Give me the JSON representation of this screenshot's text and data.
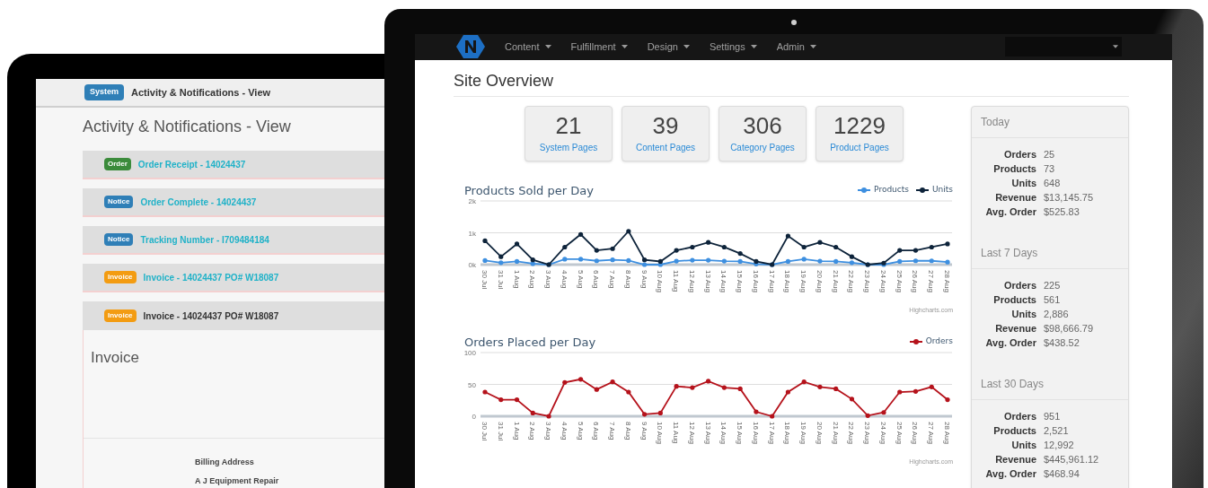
{
  "tablet": {
    "header": {
      "badge": "System",
      "title": "Activity & Notifications - View"
    },
    "heading": "Activity & Notifications - View",
    "items": [
      {
        "badge": "Order",
        "color": "#3b8b3b",
        "title": "Order Receipt - 14024437",
        "expanded": false
      },
      {
        "badge": "Notice",
        "color": "#2f7fb7",
        "title": "Order Complete - 14024437",
        "expanded": false
      },
      {
        "badge": "Notice",
        "color": "#2f7fb7",
        "title": "Tracking Number - I709484184",
        "expanded": false
      },
      {
        "badge": "Invoice",
        "color": "#f39c12",
        "title": "Invoice - 14024437 PO# W18087",
        "expanded": false
      },
      {
        "badge": "Invoice",
        "color": "#f39c12",
        "title": "Invoice - 14024437 PO# W18087",
        "expanded": true
      }
    ],
    "invoice": {
      "heading": "Invoice",
      "billing_label": "Billing Address",
      "billing_name": "A J Equipment Repair"
    }
  },
  "laptop": {
    "nav": {
      "menus": [
        "Content",
        "Fulfillment",
        "Design",
        "Settings",
        "Admin"
      ]
    },
    "title": "Site Overview",
    "stats": [
      {
        "value": "21",
        "label": "System Pages"
      },
      {
        "value": "39",
        "label": "Content Pages"
      },
      {
        "value": "306",
        "label": "Category Pages"
      },
      {
        "value": "1229",
        "label": "Product Pages"
      }
    ],
    "charts": [
      {
        "credit": "Highcharts.com",
        "chart_data": {
          "type": "line",
          "title": "Products Sold per Day",
          "categories": [
            "30 Jul",
            "31 Jul",
            "1 Aug",
            "2 Aug",
            "3 Aug",
            "4 Aug",
            "5 Aug",
            "6 Aug",
            "7 Aug",
            "8 Aug",
            "9 Aug",
            "10 Aug",
            "11 Aug",
            "12 Aug",
            "13 Aug",
            "14 Aug",
            "15 Aug",
            "16 Aug",
            "17 Aug",
            "18 Aug",
            "19 Aug",
            "20 Aug",
            "21 Aug",
            "22 Aug",
            "23 Aug",
            "24 Aug",
            "25 Aug",
            "26 Aug",
            "27 Aug",
            "28 Aug"
          ],
          "series": [
            {
              "name": "Products",
              "color": "#3d8fe0",
              "values": [
                130,
                60,
                100,
                30,
                0,
                170,
                170,
                120,
                150,
                130,
                0,
                0,
                110,
                140,
                140,
                110,
                100,
                20,
                0,
                100,
                170,
                110,
                100,
                60,
                0,
                0,
                100,
                120,
                120,
                80
              ]
            },
            {
              "name": "Units",
              "color": "#0d233a",
              "values": [
                750,
                250,
                650,
                150,
                0,
                550,
                950,
                450,
                500,
                1050,
                150,
                100,
                450,
                550,
                700,
                550,
                350,
                100,
                0,
                900,
                550,
                700,
                550,
                250,
                0,
                50,
                450,
                450,
                550,
                650
              ]
            }
          ],
          "legend": "top-right",
          "ylim": [
            0,
            2000
          ],
          "yticks": [
            {
              "value": 0,
              "label": "0k"
            },
            {
              "value": 1000,
              "label": "1k"
            },
            {
              "value": 2000,
              "label": "2k"
            }
          ]
        }
      },
      {
        "credit": "Highcharts.com",
        "chart_data": {
          "type": "line",
          "title": "Orders Placed per Day",
          "categories": [
            "30 Jul",
            "31 Jul",
            "1 Aug",
            "2 Aug",
            "3 Aug",
            "4 Aug",
            "5 Aug",
            "6 Aug",
            "7 Aug",
            "8 Aug",
            "9 Aug",
            "10 Aug",
            "11 Aug",
            "12 Aug",
            "13 Aug",
            "14 Aug",
            "15 Aug",
            "16 Aug",
            "17 Aug",
            "18 Aug",
            "19 Aug",
            "20 Aug",
            "21 Aug",
            "22 Aug",
            "23 Aug",
            "24 Aug",
            "25 Aug",
            "26 Aug",
            "27 Aug",
            "28 Aug"
          ],
          "series": [
            {
              "name": "Orders",
              "color": "#b5121b",
              "values": [
                38,
                26,
                26,
                5,
                0,
                53,
                58,
                42,
                54,
                38,
                3,
                5,
                47,
                45,
                55,
                45,
                43,
                7,
                0,
                38,
                54,
                46,
                43,
                27,
                1,
                6,
                38,
                39,
                46,
                26
              ]
            }
          ],
          "legend": "top-right",
          "ylim": [
            0,
            100
          ],
          "yticks": [
            0,
            50,
            100
          ]
        }
      }
    ],
    "summary": [
      {
        "period": "Today",
        "rows": [
          {
            "label": "Orders",
            "value": "25"
          },
          {
            "label": "Products",
            "value": "73"
          },
          {
            "label": "Units",
            "value": "648"
          },
          {
            "label": "Revenue",
            "value": "$13,145.75"
          },
          {
            "label": "Avg. Order",
            "value": "$525.83"
          }
        ]
      },
      {
        "period": "Last 7 Days",
        "rows": [
          {
            "label": "Orders",
            "value": "225"
          },
          {
            "label": "Products",
            "value": "561"
          },
          {
            "label": "Units",
            "value": "2,886"
          },
          {
            "label": "Revenue",
            "value": "$98,666.79"
          },
          {
            "label": "Avg. Order",
            "value": "$438.52"
          }
        ]
      },
      {
        "period": "Last 30 Days",
        "rows": [
          {
            "label": "Orders",
            "value": "951"
          },
          {
            "label": "Products",
            "value": "2,521"
          },
          {
            "label": "Units",
            "value": "12,992"
          },
          {
            "label": "Revenue",
            "value": "$445,961.12"
          },
          {
            "label": "Avg. Order",
            "value": "$468.94"
          }
        ]
      }
    ]
  }
}
